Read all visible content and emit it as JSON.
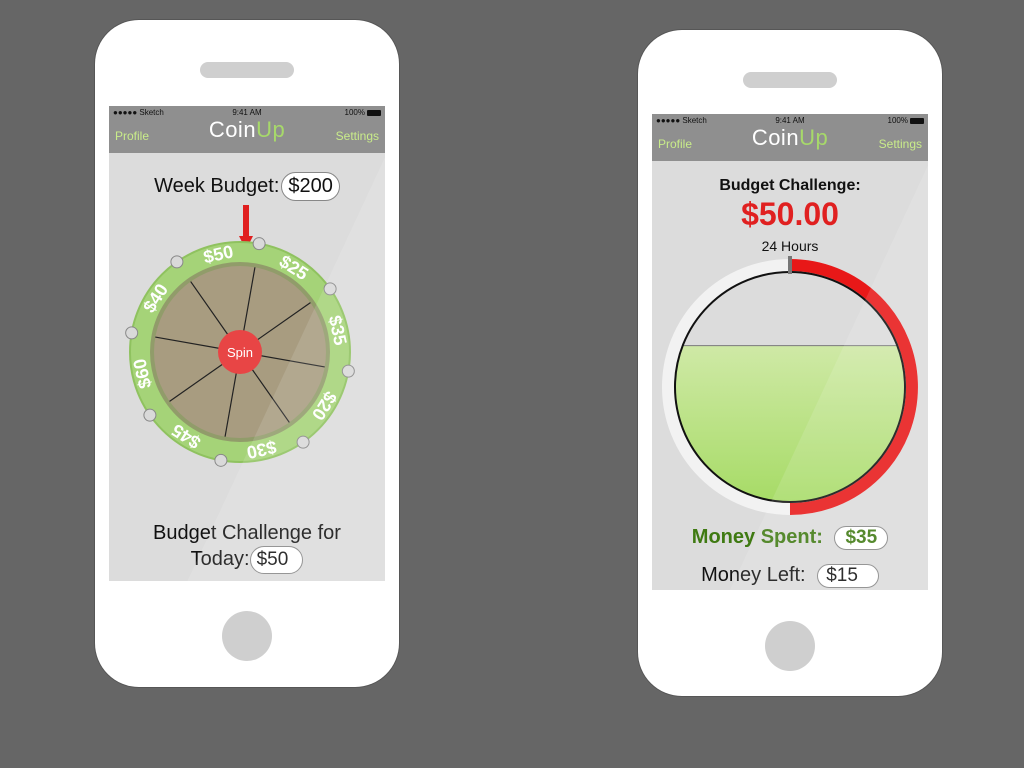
{
  "status_bar": {
    "carrier": "●●●●● Sketch",
    "time": "9:41 AM",
    "battery": "100%"
  },
  "nav": {
    "profile": "Profile",
    "logo_main": "Coin",
    "logo_accent": "Up",
    "settings": "Settings"
  },
  "left_screen": {
    "week_budget_label": "Week Budget:",
    "week_budget_value": "$200",
    "wheel_values": [
      "$50",
      "$25",
      "$35",
      "$20",
      "$30",
      "$45",
      "$60",
      "$40"
    ],
    "spin_label": "Spin",
    "challenge_label_line1": "Budget Challenge for",
    "challenge_label_line2": "Today:",
    "challenge_value": "$50"
  },
  "right_screen": {
    "challenge_title": "Budget Challenge:",
    "challenge_amount": "$50.00",
    "timer_label": "24 Hours",
    "timer_progress": 0.5,
    "fill_level": 0.68,
    "money_spent_label": "Money Spent:",
    "money_spent_value": "$35",
    "money_left_label": "Money Left:",
    "money_left_value": "$15"
  },
  "colors": {
    "background": "#666666",
    "nav_bar": "#8f8f8f",
    "accent_green": "#a7d96a",
    "red": "#e02020",
    "dark_green": "#3f7a12"
  }
}
